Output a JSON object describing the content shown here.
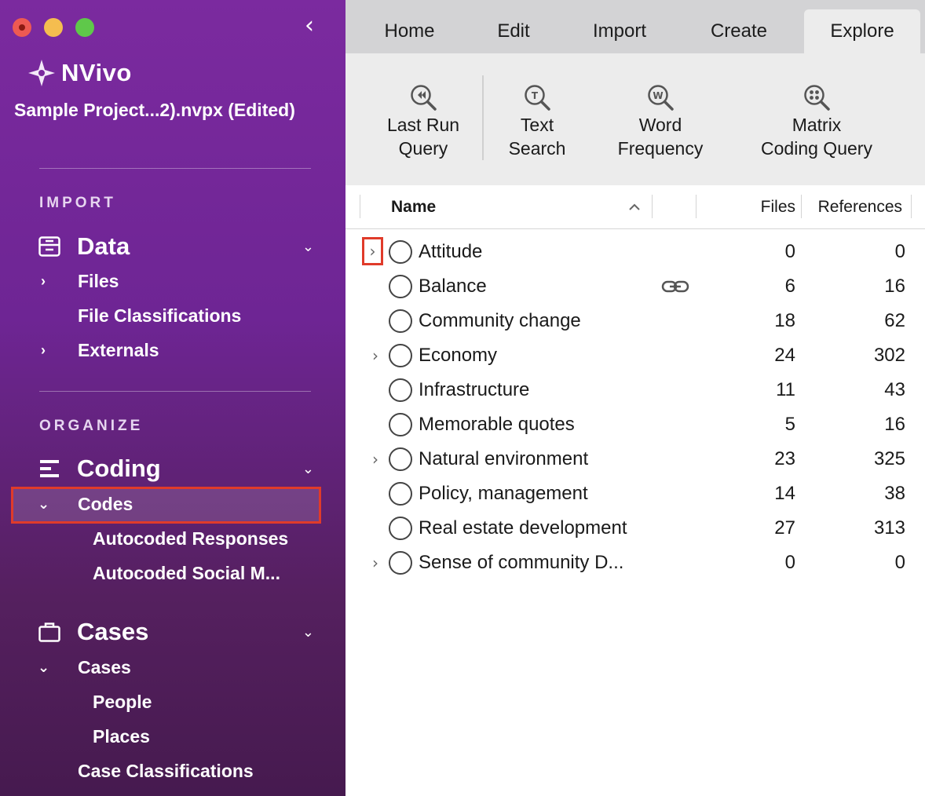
{
  "sidebar": {
    "app_name": "NVivo",
    "project_title": "Sample Project...2).nvpx (Edited)",
    "collapse_icon": "‹",
    "sections": {
      "import_label": "IMPORT",
      "organize_label": "ORGANIZE"
    },
    "data_group": {
      "title": "Data",
      "items": [
        {
          "label": "Files",
          "arrow": "›"
        },
        {
          "label": "File Classifications",
          "arrow": ""
        },
        {
          "label": "Externals",
          "arrow": "›"
        }
      ]
    },
    "coding_group": {
      "title": "Coding",
      "items": [
        {
          "label": "Codes",
          "arrow": "⌄",
          "selected": true
        },
        {
          "label": "Autocoded Responses"
        },
        {
          "label": "Autocoded Social M..."
        }
      ]
    },
    "cases_group": {
      "title": "Cases",
      "items": [
        {
          "label": "Cases",
          "arrow": "⌄"
        },
        {
          "label": "People"
        },
        {
          "label": "Places"
        },
        {
          "label": "Case Classifications"
        }
      ]
    }
  },
  "tabs": [
    {
      "label": "Home",
      "active": false
    },
    {
      "label": "Edit",
      "active": false
    },
    {
      "label": "Import",
      "active": false
    },
    {
      "label": "Create",
      "active": false
    },
    {
      "label": "Explore",
      "active": true
    }
  ],
  "ribbon": {
    "buttons": [
      {
        "line1": "Last Run",
        "line2": "Query",
        "icon": "last-run-query-icon"
      },
      {
        "line1": "Text",
        "line2": "Search",
        "icon": "text-search-icon"
      },
      {
        "line1": "Word",
        "line2": "Frequency",
        "icon": "word-frequency-icon"
      },
      {
        "line1": "Matrix",
        "line2": "Coding Query",
        "icon": "matrix-coding-query-icon"
      }
    ]
  },
  "table": {
    "columns": {
      "name": "Name",
      "files": "Files",
      "references": "References",
      "sort_indicator": "^"
    },
    "rows": [
      {
        "name": "Attitude",
        "expandable": true,
        "files": "0",
        "references": "0",
        "highlighted_expander": true
      },
      {
        "name": "Balance",
        "expandable": false,
        "files": "6",
        "references": "16",
        "linked": true
      },
      {
        "name": "Community change",
        "expandable": false,
        "files": "18",
        "references": "62"
      },
      {
        "name": "Economy",
        "expandable": true,
        "files": "24",
        "references": "302"
      },
      {
        "name": "Infrastructure",
        "expandable": false,
        "files": "11",
        "references": "43"
      },
      {
        "name": "Memorable quotes",
        "expandable": false,
        "files": "5",
        "references": "16"
      },
      {
        "name": "Natural environment",
        "expandable": true,
        "files": "23",
        "references": "325"
      },
      {
        "name": "Policy, management",
        "expandable": false,
        "files": "14",
        "references": "38"
      },
      {
        "name": "Real estate development",
        "expandable": false,
        "files": "27",
        "references": "313"
      },
      {
        "name": "Sense of community D...",
        "expandable": true,
        "files": "0",
        "references": "0"
      }
    ]
  },
  "colors": {
    "sidebar_top": "#7b2a9f",
    "sidebar_bottom": "#461a4f",
    "selection_outline": "#e03b2a",
    "tab_bar": "#d3d3d5",
    "ribbon": "#ececec"
  }
}
